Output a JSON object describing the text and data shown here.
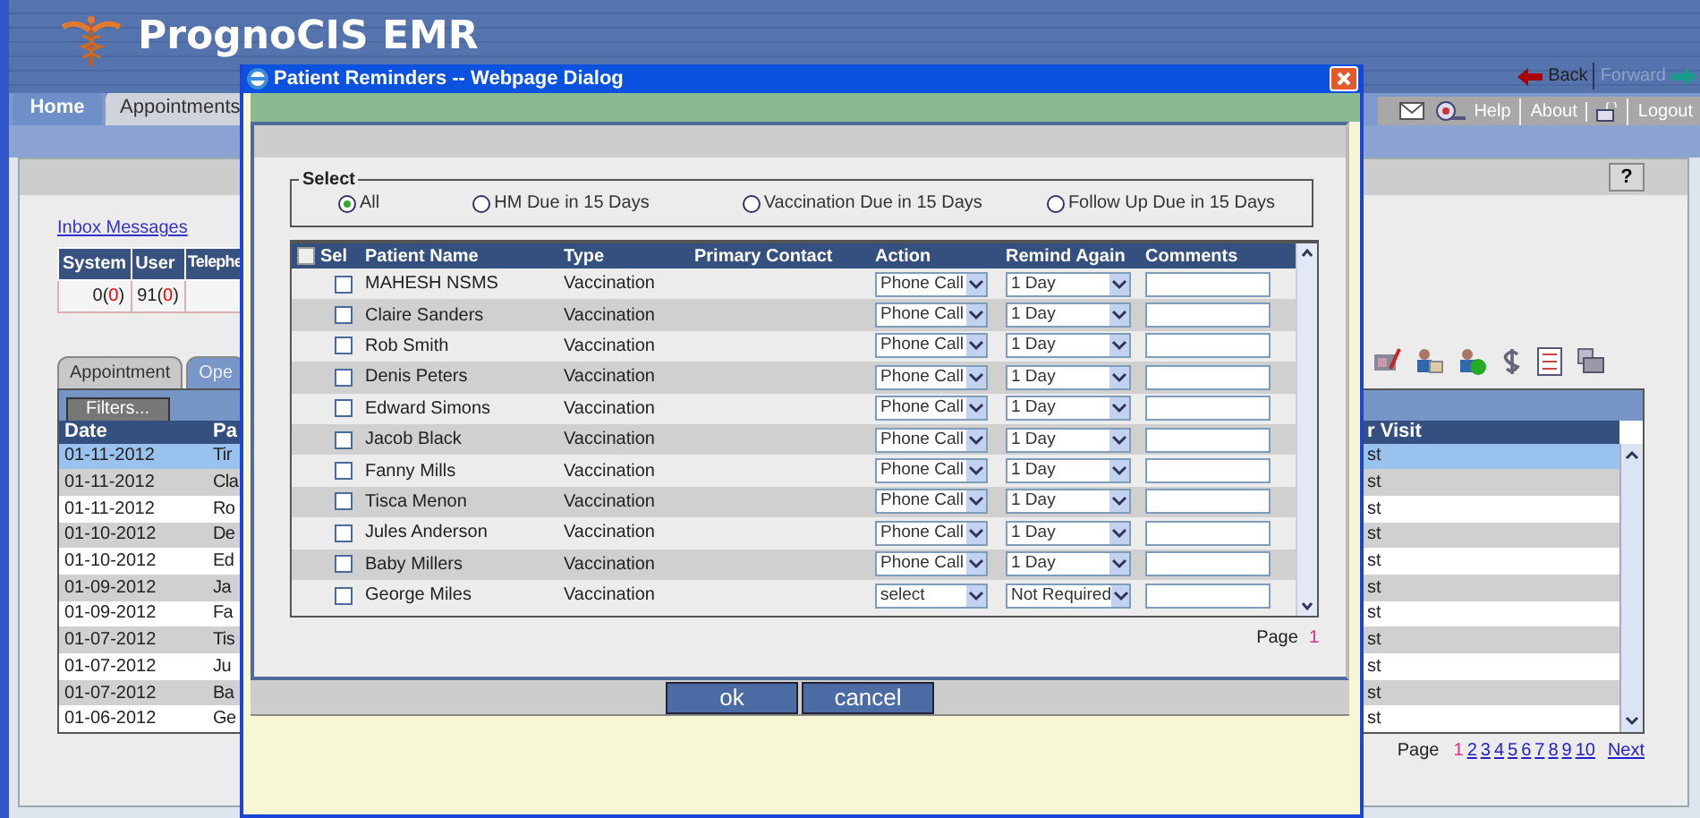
{
  "app": {
    "title": "PrognoCIS EMR",
    "nav_links": [
      {
        "label": "Back",
        "disabled": false
      },
      {
        "label": "Forward",
        "disabled": true
      }
    ],
    "tabs": [
      {
        "label": "Home",
        "selected": true
      },
      {
        "label": "Appointments",
        "selected": false
      }
    ],
    "toolbar_links": [
      "Help",
      "About",
      "Logout"
    ],
    "help_button": "?"
  },
  "inbox": {
    "link": "Inbox Messages",
    "columns": [
      "System",
      "User",
      "Telephe"
    ],
    "cells": [
      {
        "parts": [
          "0(",
          "0",
          ")"
        ]
      },
      {
        "parts": [
          "91(",
          "0",
          ")"
        ]
      }
    ]
  },
  "worklist": {
    "tabs": [
      {
        "label": "Appointment",
        "selected": false
      },
      {
        "label": "Ope",
        "selected": true
      }
    ],
    "filters": "Filters...",
    "columns": [
      "Date",
      "Pa",
      "r Visit"
    ],
    "rows": [
      {
        "date": "01-11-2012",
        "patient": "Tir",
        "visit": "st",
        "selected": true
      },
      {
        "date": "01-11-2012",
        "patient": "Cla",
        "visit": "st",
        "selected": false
      },
      {
        "date": "01-11-2012",
        "patient": "Ro",
        "visit": "st",
        "selected": false
      },
      {
        "date": "01-10-2012",
        "patient": "De",
        "visit": "st",
        "selected": false
      },
      {
        "date": "01-10-2012",
        "patient": "Ed",
        "visit": "st",
        "selected": false
      },
      {
        "date": "01-09-2012",
        "patient": "Ja",
        "visit": "st",
        "selected": false
      },
      {
        "date": "01-09-2012",
        "patient": "Fa",
        "visit": "st",
        "selected": false
      },
      {
        "date": "01-07-2012",
        "patient": "Tis",
        "visit": "st",
        "selected": false
      },
      {
        "date": "01-07-2012",
        "patient": "Ju",
        "visit": "st",
        "selected": false
      },
      {
        "date": "01-07-2012",
        "patient": "Ba",
        "visit": "st",
        "selected": false
      },
      {
        "date": "01-06-2012",
        "patient": "Ge",
        "visit": "st",
        "selected": false
      }
    ],
    "pager": {
      "label": "Page",
      "pages": [
        {
          "label": "1",
          "selected": true
        },
        {
          "label": "2",
          "selected": false
        },
        {
          "label": "3",
          "selected": false
        },
        {
          "label": "4",
          "selected": false
        },
        {
          "label": "5",
          "selected": false
        },
        {
          "label": "6",
          "selected": false
        },
        {
          "label": "7",
          "selected": false
        },
        {
          "label": "8",
          "selected": false
        },
        {
          "label": "9",
          "selected": false
        },
        {
          "label": "10",
          "selected": false
        }
      ],
      "next": "Next"
    }
  },
  "dialog": {
    "title": "Patient Reminders -- Webpage Dialog",
    "filter": {
      "legend": "Select",
      "options": [
        {
          "label": "All",
          "selected": true
        },
        {
          "label": "HM Due in 15 Days",
          "selected": false
        },
        {
          "label": "Vaccination Due in 15 Days",
          "selected": false
        },
        {
          "label": "Follow Up Due in 15 Days",
          "selected": false
        }
      ]
    },
    "select_all": false,
    "columns": [
      "Sel",
      "Patient Name",
      "Type",
      "Primary Contact",
      "Action",
      "Remind Again",
      "Comments"
    ],
    "rows": [
      {
        "checked": false,
        "name": "MAHESH NSMS",
        "type": "Vaccination",
        "action": "Phone Call",
        "remind": "1 Day"
      },
      {
        "checked": false,
        "name": "Claire Sanders",
        "type": "Vaccination",
        "action": "Phone Call",
        "remind": "1 Day"
      },
      {
        "checked": false,
        "name": "Rob Smith",
        "type": "Vaccination",
        "action": "Phone Call",
        "remind": "1 Day"
      },
      {
        "checked": false,
        "name": "Denis Peters",
        "type": "Vaccination",
        "action": "Phone Call",
        "remind": "1 Day"
      },
      {
        "checked": false,
        "name": "Edward Simons",
        "type": "Vaccination",
        "action": "Phone Call",
        "remind": "1 Day"
      },
      {
        "checked": false,
        "name": "Jacob Black",
        "type": "Vaccination",
        "action": "Phone Call",
        "remind": "1 Day"
      },
      {
        "checked": false,
        "name": "Fanny Mills",
        "type": "Vaccination",
        "action": "Phone Call",
        "remind": "1 Day"
      },
      {
        "checked": false,
        "name": "Tisca Menon",
        "type": "Vaccination",
        "action": "Phone Call",
        "remind": "1 Day"
      },
      {
        "checked": false,
        "name": "Jules Anderson",
        "type": "Vaccination",
        "action": "Phone Call",
        "remind": "1 Day"
      },
      {
        "checked": false,
        "name": "Baby Millers",
        "type": "Vaccination",
        "action": "Phone Call",
        "remind": "1 Day"
      },
      {
        "checked": false,
        "name": "George Miles",
        "type": "Vaccination",
        "action": "select",
        "remind": "Not Required"
      }
    ],
    "page": {
      "label": "Page",
      "number": "1"
    },
    "buttons": [
      "ok",
      "cancel"
    ]
  }
}
